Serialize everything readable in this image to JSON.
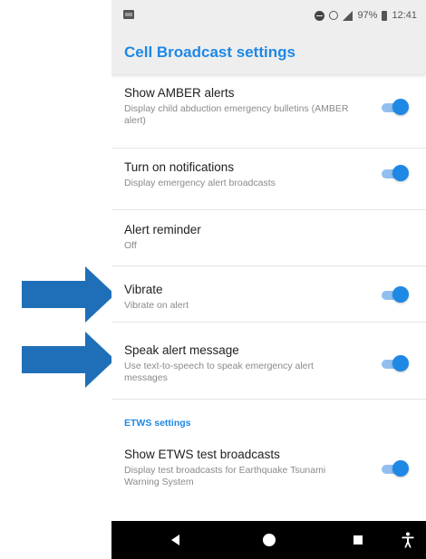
{
  "status_bar": {
    "battery_percent": "97%",
    "time": "12:41"
  },
  "app_bar": {
    "title": "Cell Broadcast settings"
  },
  "settings": [
    {
      "title": "Show AMBER alerts",
      "summary": "Display child abduction emergency bulletins (AMBER alert)",
      "toggle": true
    },
    {
      "title": "Turn on notifications",
      "summary": "Display emergency alert broadcasts",
      "toggle": true
    },
    {
      "title": "Alert reminder",
      "summary": "Off",
      "toggle": null
    },
    {
      "title": "Vibrate",
      "summary": "Vibrate on alert",
      "toggle": true
    },
    {
      "title": "Speak alert message",
      "summary": "Use text-to-speech to speak emergency alert messages",
      "toggle": true
    }
  ],
  "etws": {
    "category": "ETWS settings",
    "title": "Show ETWS test broadcasts",
    "summary": "Display test broadcasts for Earthquake Tsunami Warning System",
    "toggle": true
  },
  "colors": {
    "accent": "#1e88e5",
    "toggle_track": "#90bff0",
    "toggle_thumb": "#1e88e5",
    "annotation_arrow": "#1f6fb8"
  },
  "icons": {
    "status_left": "image-notification-icon",
    "dnd": "do-not-disturb-icon",
    "alarm": "alarm-icon",
    "signal": "cell-signal-icon",
    "battery": "battery-icon",
    "nav_back": "back-icon",
    "nav_home": "home-icon",
    "nav_recents": "recents-icon",
    "nav_accessibility": "accessibility-icon",
    "annotation": "arrow-right-icon"
  }
}
